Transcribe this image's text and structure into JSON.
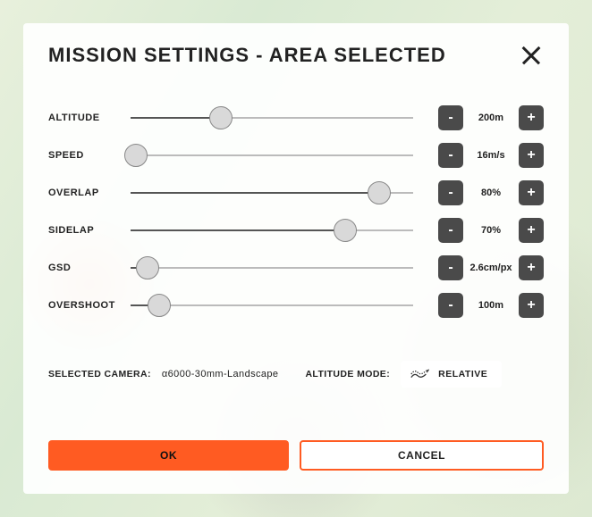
{
  "header": {
    "title": "MISSION  SETTINGS - AREA SELECTED"
  },
  "settings": [
    {
      "key": "altitude",
      "label": "ALTITUDE",
      "value": "200m",
      "percent": 32
    },
    {
      "key": "speed",
      "label": "SPEED",
      "value": "16m/s",
      "percent": 2
    },
    {
      "key": "overlap",
      "label": "OVERLAP",
      "value": "80%",
      "percent": 88
    },
    {
      "key": "sidelap",
      "label": "SIDELAP",
      "value": "70%",
      "percent": 76
    },
    {
      "key": "gsd",
      "label": "GSD",
      "value": "2.6cm/px",
      "percent": 6
    },
    {
      "key": "overshoot",
      "label": "OVERSHOOT",
      "value": "100m",
      "percent": 10
    }
  ],
  "camera": {
    "label": "SELECTED CAMERA:",
    "value": "α6000-30mm-Landscape"
  },
  "altitude_mode": {
    "label": "ALTITUDE MODE:",
    "value": "RELATIVE"
  },
  "footer": {
    "ok": "OK",
    "cancel": "CANCEL"
  },
  "colors": {
    "accent": "#ff5b22",
    "dark": "#4a4a4a"
  }
}
